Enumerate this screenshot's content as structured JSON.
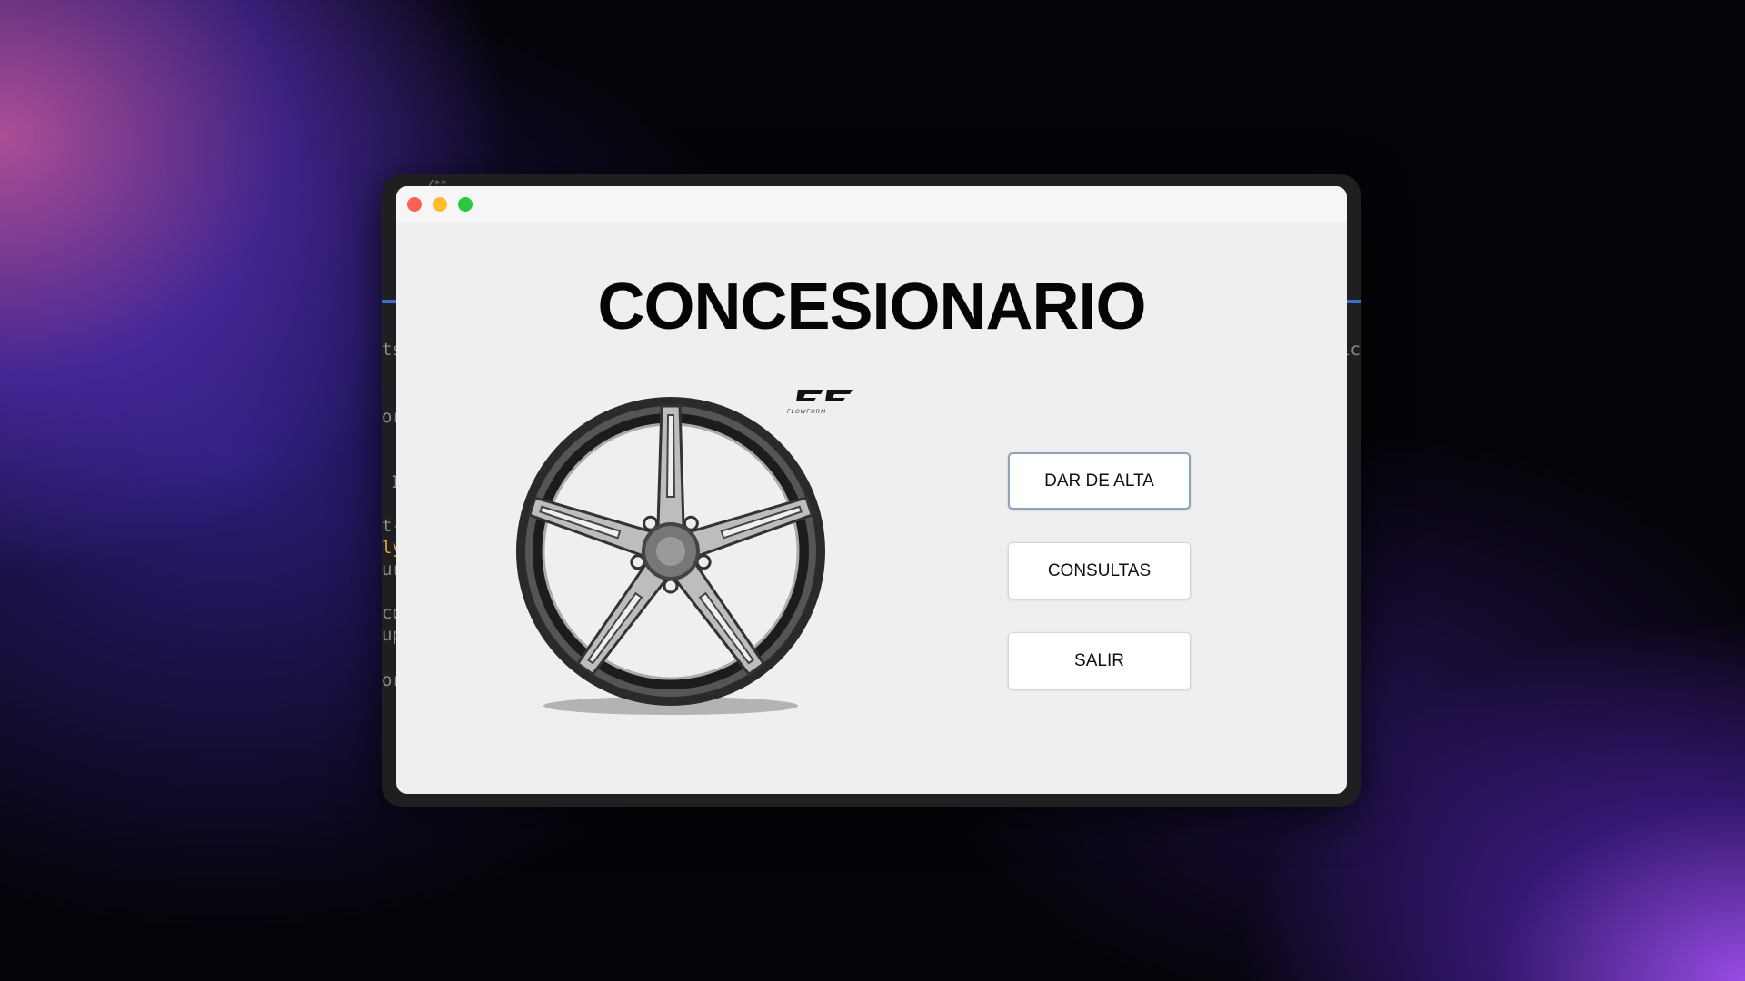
{
  "background_code": {
    "left_fragments": [
      "ts",
      "or",
      "I",
      "t-",
      "ly",
      "ur",
      "co",
      "up",
      "or"
    ],
    "right_fragments": [
      "ic"
    ],
    "top_fragment": "/**"
  },
  "window": {
    "controls": {
      "close_color": "#fe5f57",
      "minimize_color": "#febc2e",
      "maximize_color": "#28c840"
    },
    "title": "CONCESIONARIO",
    "image": {
      "brand": "FLOWFORM",
      "icon": "alloy-wheel-image"
    },
    "buttons": [
      {
        "label": "DAR DE ALTA",
        "focused": true
      },
      {
        "label": "CONSULTAS",
        "focused": false
      },
      {
        "label": "SALIR",
        "focused": false
      }
    ]
  }
}
